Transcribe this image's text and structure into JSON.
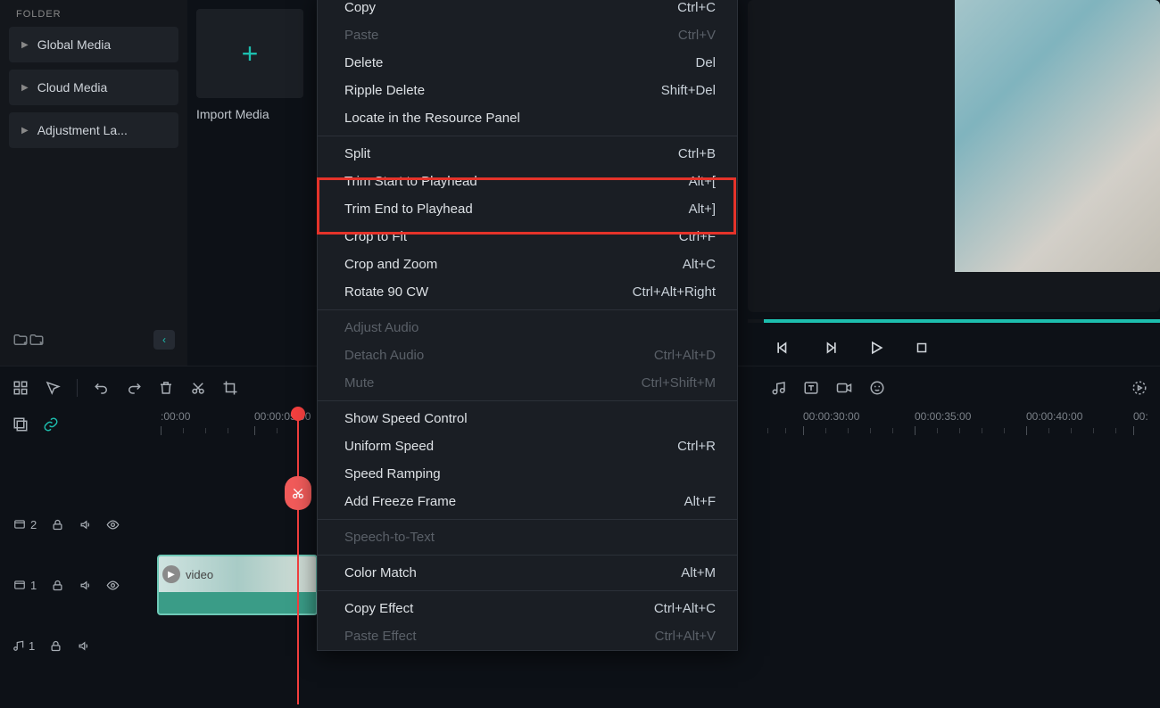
{
  "sidebar": {
    "folder_label": "FOLDER",
    "items": [
      {
        "label": "Global Media"
      },
      {
        "label": "Cloud Media"
      },
      {
        "label": "Adjustment La..."
      }
    ]
  },
  "media": {
    "import_label": "Import Media"
  },
  "context_menu": {
    "groups": [
      [
        {
          "label": "Copy",
          "shortcut": "Ctrl+C",
          "disabled": false
        },
        {
          "label": "Paste",
          "shortcut": "Ctrl+V",
          "disabled": true
        },
        {
          "label": "Delete",
          "shortcut": "Del",
          "disabled": false
        },
        {
          "label": "Ripple Delete",
          "shortcut": "Shift+Del",
          "disabled": false
        },
        {
          "label": "Locate in the Resource Panel",
          "shortcut": "",
          "disabled": false
        }
      ],
      [
        {
          "label": "Split",
          "shortcut": "Ctrl+B",
          "disabled": false
        },
        {
          "label": "Trim Start to Playhead",
          "shortcut": "Alt+[",
          "disabled": false
        },
        {
          "label": "Trim End to Playhead",
          "shortcut": "Alt+]",
          "disabled": false
        },
        {
          "label": "Crop to Fit",
          "shortcut": "Ctrl+F",
          "disabled": false
        },
        {
          "label": "Crop and Zoom",
          "shortcut": "Alt+C",
          "disabled": false
        },
        {
          "label": "Rotate 90 CW",
          "shortcut": "Ctrl+Alt+Right",
          "disabled": false
        }
      ],
      [
        {
          "label": "Adjust Audio",
          "shortcut": "",
          "disabled": true
        },
        {
          "label": "Detach Audio",
          "shortcut": "Ctrl+Alt+D",
          "disabled": true
        },
        {
          "label": "Mute",
          "shortcut": "Ctrl+Shift+M",
          "disabled": true
        }
      ],
      [
        {
          "label": "Show Speed Control",
          "shortcut": "",
          "disabled": false
        },
        {
          "label": "Uniform Speed",
          "shortcut": "Ctrl+R",
          "disabled": false
        },
        {
          "label": "Speed Ramping",
          "shortcut": "",
          "disabled": false
        },
        {
          "label": "Add Freeze Frame",
          "shortcut": "Alt+F",
          "disabled": false
        }
      ],
      [
        {
          "label": "Speech-to-Text",
          "shortcut": "",
          "disabled": true
        }
      ],
      [
        {
          "label": "Color Match",
          "shortcut": "Alt+M",
          "disabled": false
        }
      ],
      [
        {
          "label": "Copy Effect",
          "shortcut": "Ctrl+Alt+C",
          "disabled": false
        },
        {
          "label": "Paste Effect",
          "shortcut": "Ctrl+Alt+V",
          "disabled": true
        }
      ]
    ]
  },
  "timeline": {
    "ruler": [
      ":00:00",
      "00:00:05:00",
      "00:00:30:00",
      "00:00:35:00",
      "00:00:40:00",
      "00:"
    ],
    "tracks": {
      "video2": "2",
      "video1": "1",
      "audio1": "1"
    },
    "clip": {
      "name": "video"
    }
  },
  "colors": {
    "accent": "#1dbfaf",
    "playhead": "#f4403f",
    "highlight": "#e5332a"
  }
}
